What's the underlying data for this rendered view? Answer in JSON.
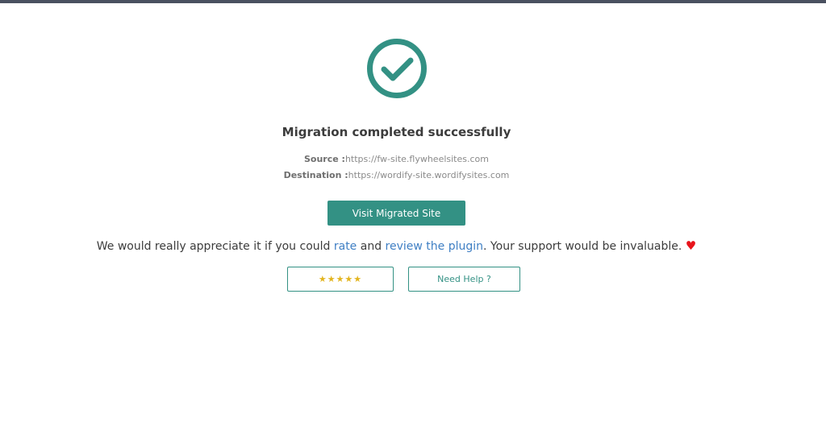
{
  "status": {
    "title": "Migration completed successfully",
    "source_label": "Source :",
    "source_value": "https://fw-site.flywheelsites.com",
    "destination_label": "Destination :",
    "destination_value": "https://wordify-site.wordifysites.com",
    "accent_color": "#339184",
    "icon": "check-circle-icon"
  },
  "actions": {
    "visit_label": "Visit Migrated Site",
    "rate_stars": "★★★★★",
    "help_label": "Need Help ?"
  },
  "appreciation": {
    "prefix": "We would really appreciate it if you could ",
    "rate_link": "rate",
    "middle": " and ",
    "review_link": "review the plugin",
    "suffix": ". Your support would be invaluable. ",
    "heart": "♥",
    "link_color": "#3f7fc4",
    "heart_color": "#e8141b"
  }
}
